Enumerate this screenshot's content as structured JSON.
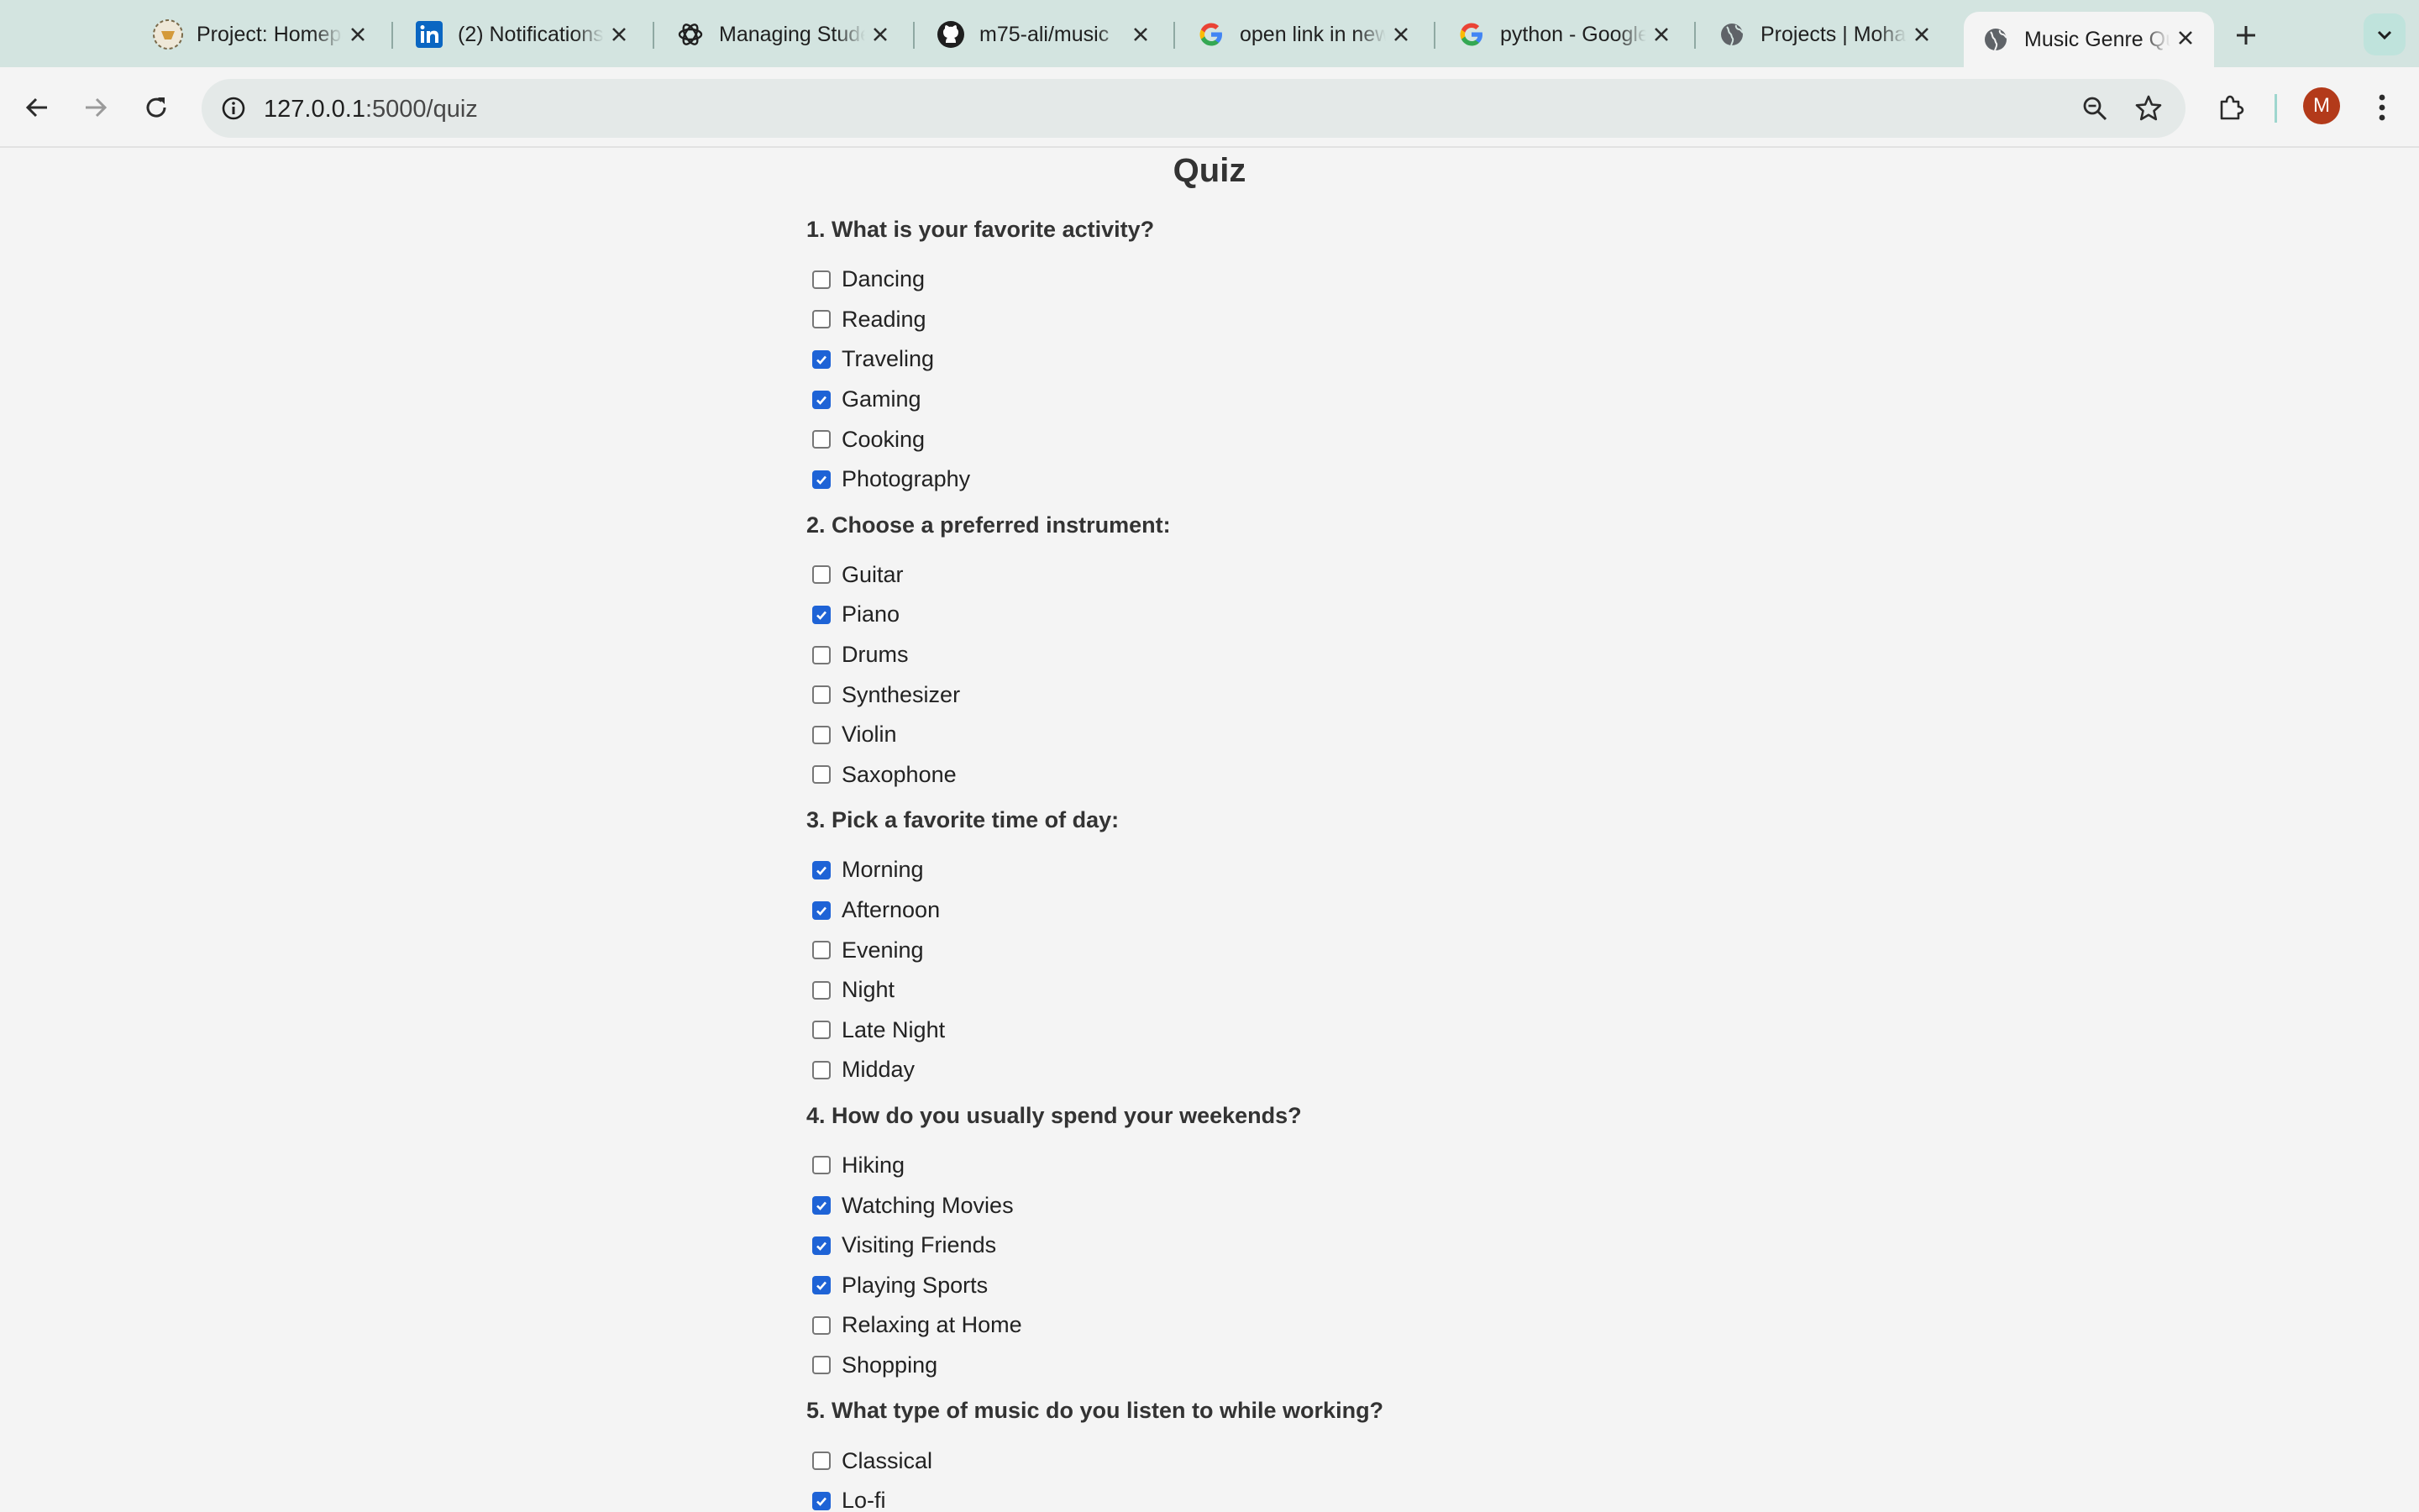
{
  "browser": {
    "tabs": [
      {
        "title": "Project: Homepage",
        "icon": "project-icon",
        "active": false
      },
      {
        "title": "(2) Notifications",
        "icon": "linkedin-icon",
        "active": false
      },
      {
        "title": "Managing Students",
        "icon": "chatgpt-icon",
        "active": false
      },
      {
        "title": "m75-ali/music",
        "icon": "github-icon",
        "active": false
      },
      {
        "title": "open link in new tab",
        "icon": "google-icon",
        "active": false
      },
      {
        "title": "python - Google Search",
        "icon": "google-icon",
        "active": false
      },
      {
        "title": "Projects | Mohammed",
        "icon": "globe-icon",
        "active": false
      },
      {
        "title": "Music Genre Quiz",
        "icon": "globe-icon",
        "active": true
      }
    ],
    "url_host": "127.0.0.1",
    "url_path": ":5000/quiz",
    "avatar_letter": "M",
    "accent": "#1e63d6"
  },
  "page": {
    "title": "Quiz",
    "questions": [
      {
        "label": "1. What is your favorite activity?",
        "options": [
          {
            "label": "Dancing",
            "checked": false
          },
          {
            "label": "Reading",
            "checked": false
          },
          {
            "label": "Traveling",
            "checked": true
          },
          {
            "label": "Gaming",
            "checked": true
          },
          {
            "label": "Cooking",
            "checked": false
          },
          {
            "label": "Photography",
            "checked": true
          }
        ]
      },
      {
        "label": "2. Choose a preferred instrument:",
        "options": [
          {
            "label": "Guitar",
            "checked": false
          },
          {
            "label": "Piano",
            "checked": true
          },
          {
            "label": "Drums",
            "checked": false
          },
          {
            "label": "Synthesizer",
            "checked": false
          },
          {
            "label": "Violin",
            "checked": false
          },
          {
            "label": "Saxophone",
            "checked": false
          }
        ]
      },
      {
        "label": "3. Pick a favorite time of day:",
        "options": [
          {
            "label": "Morning",
            "checked": true
          },
          {
            "label": "Afternoon",
            "checked": true
          },
          {
            "label": "Evening",
            "checked": false
          },
          {
            "label": "Night",
            "checked": false
          },
          {
            "label": "Late Night",
            "checked": false
          },
          {
            "label": "Midday",
            "checked": false
          }
        ]
      },
      {
        "label": "4. How do you usually spend your weekends?",
        "options": [
          {
            "label": "Hiking",
            "checked": false
          },
          {
            "label": "Watching Movies",
            "checked": true
          },
          {
            "label": "Visiting Friends",
            "checked": true
          },
          {
            "label": "Playing Sports",
            "checked": true
          },
          {
            "label": "Relaxing at Home",
            "checked": false
          },
          {
            "label": "Shopping",
            "checked": false
          }
        ]
      },
      {
        "label": "5. What type of music do you listen to while working?",
        "options": [
          {
            "label": "Classical",
            "checked": false
          },
          {
            "label": "Lo-fi",
            "checked": true
          }
        ]
      }
    ]
  }
}
